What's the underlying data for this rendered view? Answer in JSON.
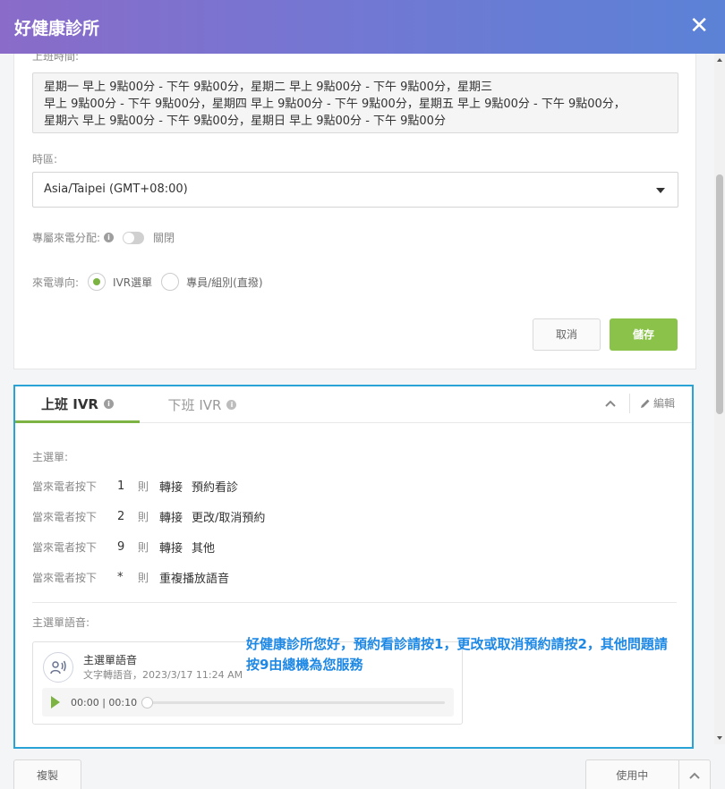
{
  "header": {
    "title": "好健康診所",
    "close_icon": "close-icon"
  },
  "settings": {
    "hours_label": "上班時間:",
    "hours_lines": "星期一 早上 9點00分 - 下午 9點00分，星期二 早上 9點00分 - 下午 9點00分，星期三\n 早上 9點00分 - 下午 9點00分，星期四 早上 9點00分 - 下午 9點00分，星期五 早上 9點00分 - 下午 9點00分，\n星期六 早上 9點00分 - 下午 9點00分，星期日 早上 9點00分 - 下午 9點00分",
    "timezone_label": "時區:",
    "timezone_value": "Asia/Taipei (GMT+08:00)",
    "dedicated_label": "專屬來電分配:",
    "dedicated_state": "關閉",
    "routing_label": "來電導向:",
    "routing_options": [
      "IVR選單",
      "專員/組別(直撥)"
    ],
    "routing_selected": 0,
    "cancel_label": "取消",
    "save_label": "儲存"
  },
  "ivr": {
    "tabs": [
      "上班 IVR",
      "下班 IVR"
    ],
    "active_tab": 0,
    "edit_label": "編輯",
    "main_menu_label": "主選單:",
    "rows": [
      {
        "prefix": "當來電者按下",
        "key": "1",
        "then": "則",
        "action": "轉接",
        "target": "預約看診"
      },
      {
        "prefix": "當來電者按下",
        "key": "2",
        "then": "則",
        "action": "轉接",
        "target": "更改/取消預約"
      },
      {
        "prefix": "當來電者按下",
        "key": "9",
        "then": "則",
        "action": "轉接",
        "target": "其他"
      },
      {
        "prefix": "當來電者按下",
        "key": "*",
        "then": "則",
        "action": "重複播放語音",
        "target": ""
      }
    ],
    "voice_label": "主選單語音:",
    "voice": {
      "name": "主選單語音",
      "meta": "文字轉語音，2023/3/17 11:24 AM",
      "time": "00:00 | 00:10",
      "progress": 0
    },
    "transcript": "好健康診所您好，預約看診請按1，更改或取消預約請按2，其他問題請按9由總機為您服務"
  },
  "footer": {
    "copy_label": "複製",
    "status_label": "使用中"
  },
  "colors": {
    "accent_green": "#7cb342",
    "focus_blue": "#29a3d6",
    "text_blue": "#1e88e5"
  }
}
